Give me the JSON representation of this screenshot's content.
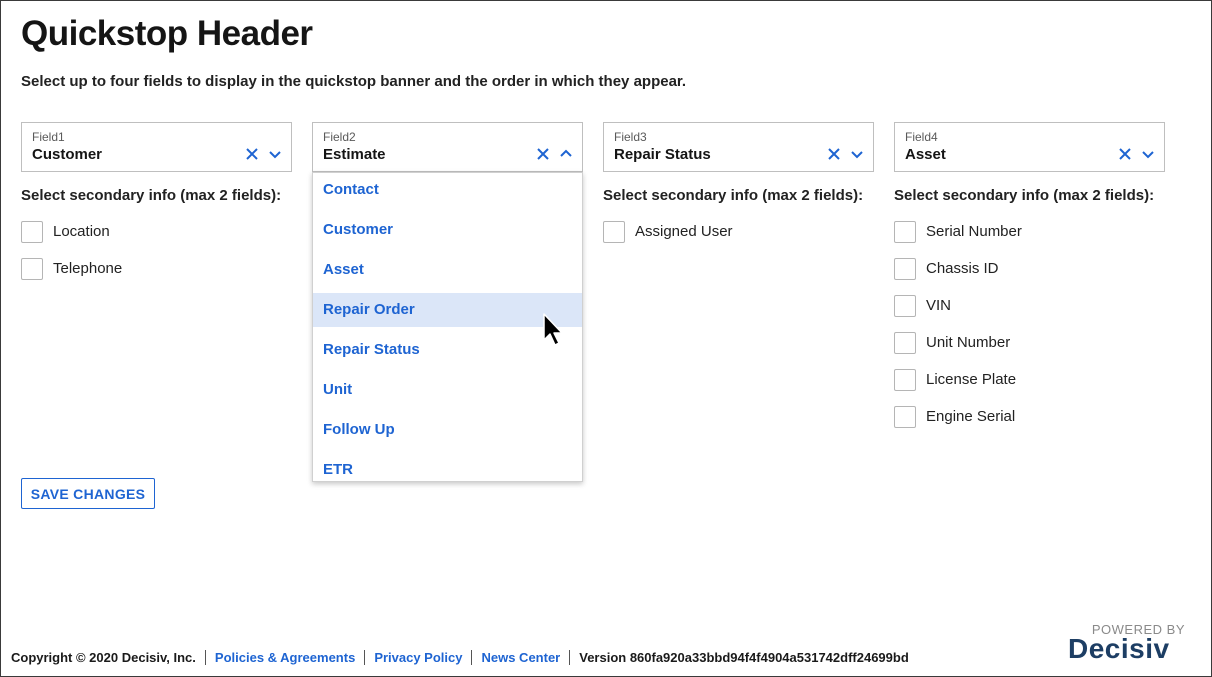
{
  "page": {
    "title": "Quickstop Header",
    "subtitle": "Select up to four fields to display in the quickstop banner and the order in which they appear."
  },
  "fields": [
    {
      "label": "Field1",
      "value": "Customer",
      "secondary_title": "Select secondary info (max 2 fields):",
      "options": [
        {
          "label": "Location",
          "checked": false
        },
        {
          "label": "Telephone",
          "checked": false
        }
      ]
    },
    {
      "label": "Field2",
      "value": "Estimate",
      "secondary_title": "Select secondary info (max 2 fields):",
      "options": []
    },
    {
      "label": "Field3",
      "value": "Repair Status",
      "secondary_title": "Select secondary info (max 2 fields):",
      "options": [
        {
          "label": "Assigned User",
          "checked": false
        }
      ]
    },
    {
      "label": "Field4",
      "value": "Asset",
      "secondary_title": "Select secondary info (max 2 fields):",
      "options": [
        {
          "label": "Serial Number",
          "checked": false
        },
        {
          "label": "Chassis ID",
          "checked": false
        },
        {
          "label": "VIN",
          "checked": false
        },
        {
          "label": "Unit Number",
          "checked": false
        },
        {
          "label": "License Plate",
          "checked": false
        },
        {
          "label": "Engine Serial",
          "checked": false
        }
      ]
    }
  ],
  "dropdown": {
    "for_field": "Field2",
    "highlighted": "Repair Order",
    "options": [
      "Contact",
      "Customer",
      "Asset",
      "Repair Order",
      "Repair Status",
      "Unit",
      "Follow Up",
      "ETR"
    ]
  },
  "actions": {
    "save_label": "SAVE CHANGES"
  },
  "footer": {
    "copyright": "Copyright © 2020 Decisiv, Inc.",
    "links": [
      "Policies & Agreements",
      "Privacy Policy",
      "News Center"
    ],
    "version": "Version 860fa920a33bbd94f4f4904a531742dff24699bd"
  },
  "logo": {
    "tagline": "POWERED BY",
    "brand": "Decisiv"
  },
  "colors": {
    "accent": "#1e64d2",
    "highlight": "#dbe6f8",
    "brand": "#1d3e64"
  },
  "icons": [
    "clear-icon",
    "chevron-down-icon",
    "chevron-up-icon",
    "mouse-pointer-icon"
  ]
}
